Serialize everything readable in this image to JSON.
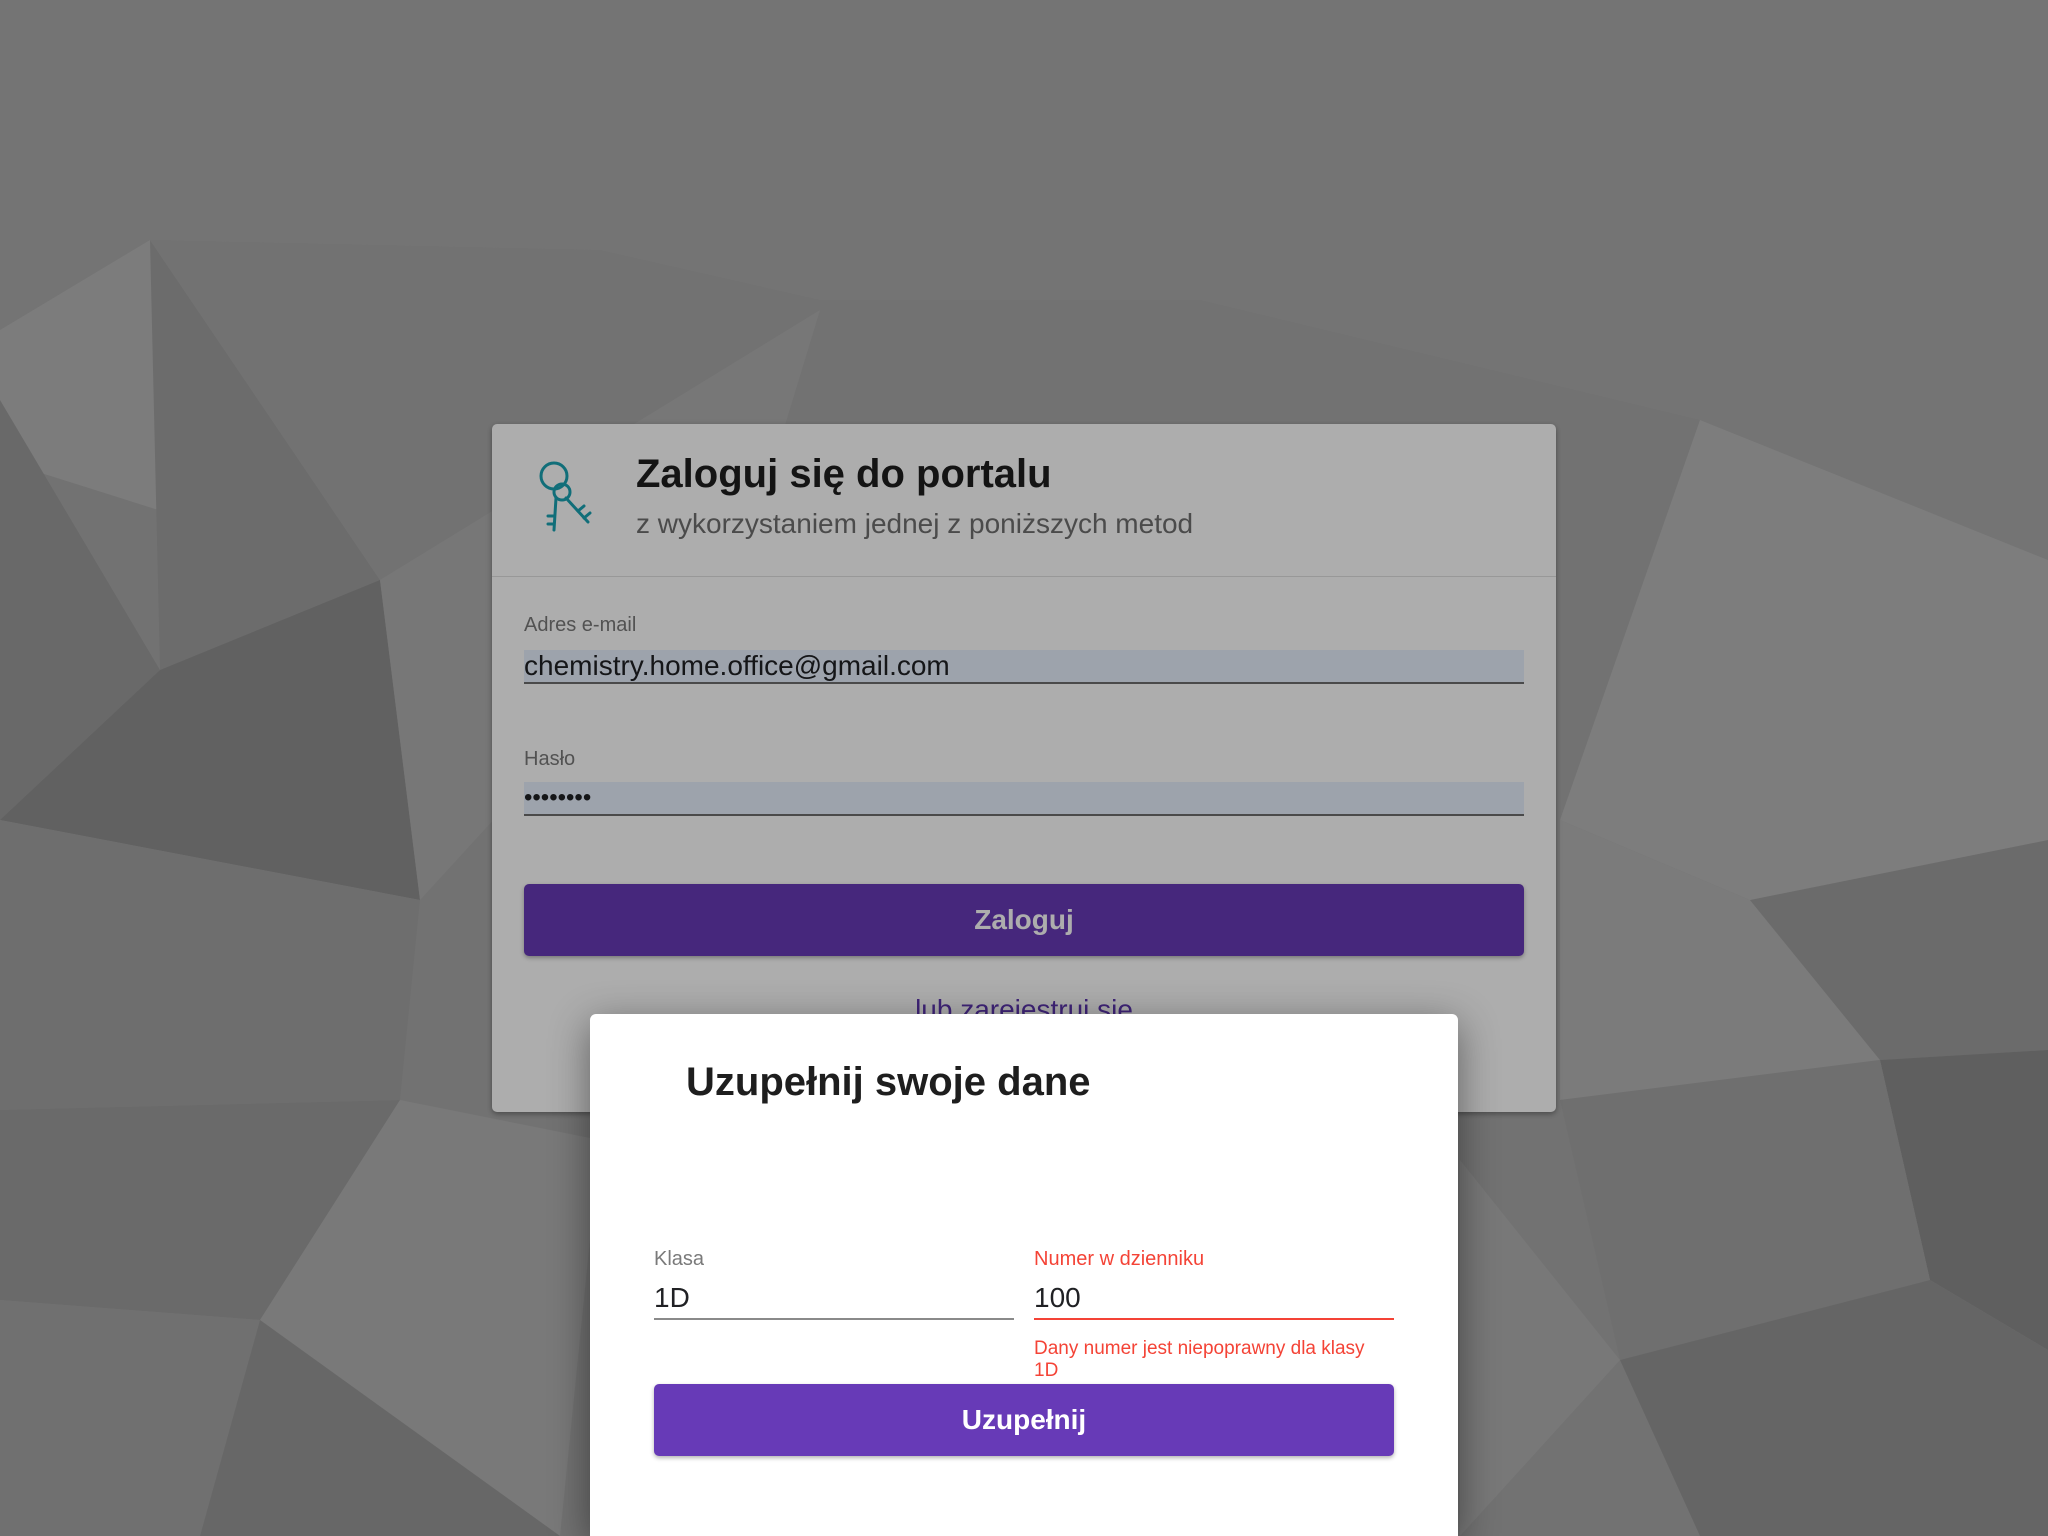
{
  "login": {
    "title": "Zaloguj się do portalu",
    "subtitle": "z wykorzystaniem jednej z poniższych metod",
    "email_label": "Adres e-mail",
    "email_value": "chemistry.home.office@gmail.com",
    "password_label": "Hasło",
    "password_value": "secret12",
    "submit_label": "Zaloguj",
    "register_link": "lub zarejestruj się"
  },
  "dialog": {
    "title": "Uzupełnij swoje dane",
    "class_label": "Klasa",
    "class_value": "1D",
    "number_label": "Numer w dzienniku",
    "number_value": "100",
    "number_error": "Dany numer jest niepoprawny dla klasy 1D",
    "submit_label": "Uzupełnij"
  },
  "colors": {
    "primary": "#673ab7",
    "error": "#f44336",
    "autofill_background": "#e8f0fe",
    "key_icon": "#1aa3b3"
  },
  "icons": {
    "header": "keys-icon"
  }
}
